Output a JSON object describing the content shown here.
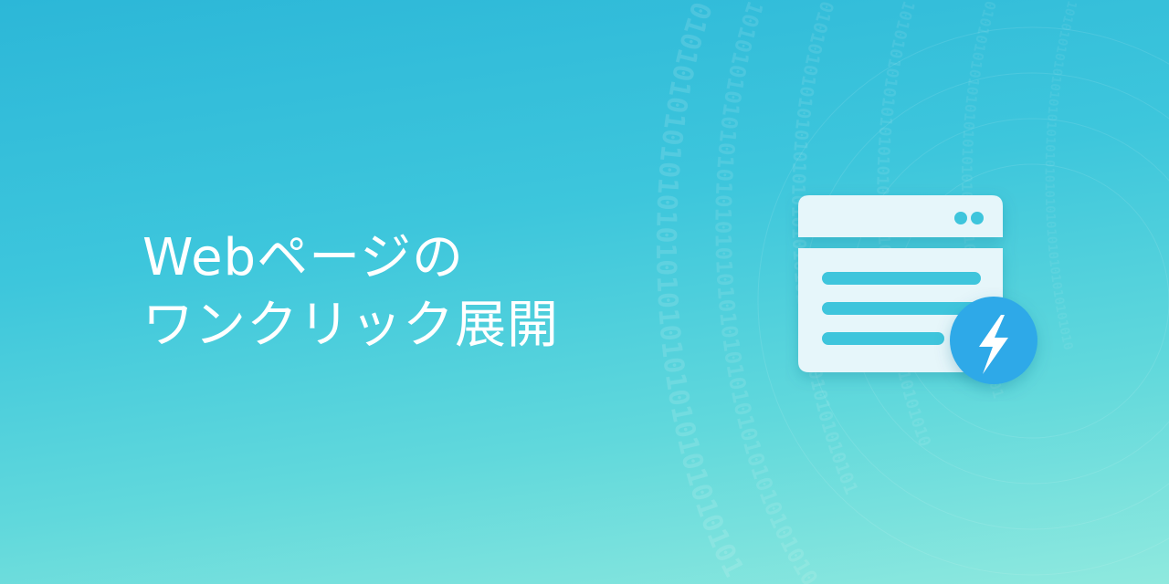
{
  "banner": {
    "headline_line1": "Webページの",
    "headline_line2": "ワンクリック展開",
    "background_pattern": "binary-digits",
    "binary_text": "0101010101010101010101010101010101010101010101",
    "binary_alt": "1010101010101010101010101010101010101010101010",
    "icon": "browser-window-with-lightning-icon",
    "colors": {
      "gradient_top": "#2cb7d8",
      "gradient_bottom": "#8fe9de",
      "window": "#e6f6fa",
      "bolt_badge": "#2fa9e8",
      "text": "#ffffff"
    }
  }
}
